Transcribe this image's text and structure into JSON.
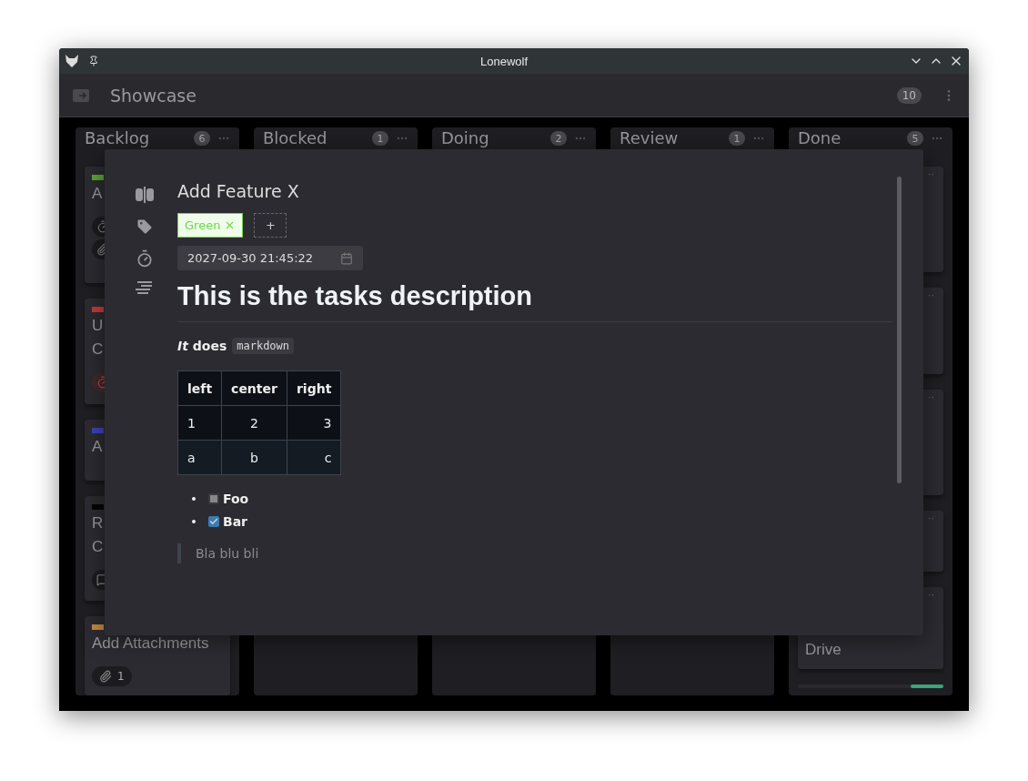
{
  "window": {
    "title": "Lonewolf"
  },
  "header": {
    "title": "Showcase",
    "count": "10"
  },
  "columns": [
    {
      "title": "Backlog",
      "count": "6",
      "cards": [
        {
          "color": "#5ba832",
          "lines": [
            "A"
          ],
          "badges": [
            {
              "kind": "timer",
              "overdue": false
            },
            {
              "kind": "attachment",
              "overdue": false
            }
          ]
        },
        {
          "color": "#c23b3b",
          "lines": [
            "U",
            "C"
          ],
          "badges": [
            {
              "kind": "timer",
              "overdue": true
            }
          ]
        },
        {
          "color": "#3b44b8",
          "lines": [
            "A"
          ]
        },
        {
          "color": "#050505",
          "lines": [
            "R",
            "C"
          ],
          "badges": [
            {
              "kind": "comment",
              "overdue": false
            }
          ]
        },
        {
          "color": "#c38a45",
          "lines": [
            "Add Attachments"
          ],
          "badges": [
            {
              "kind": "attachment",
              "overdue": false,
              "count": "1"
            }
          ]
        }
      ]
    },
    {
      "title": "Blocked",
      "count": "1"
    },
    {
      "title": "Doing",
      "count": "2"
    },
    {
      "title": "Review",
      "count": "1"
    },
    {
      "title": "Done",
      "count": "5",
      "cards": [
        {
          "menu": "··"
        },
        {
          "menu": "··"
        },
        {
          "menu": "··"
        },
        {
          "menu": "··"
        },
        {
          "menu": "··",
          "lines": [
            "Drive"
          ]
        }
      ]
    }
  ],
  "task": {
    "title": "Add Feature X",
    "tags": [
      {
        "label": "Green",
        "color": "#6fd64a"
      }
    ],
    "add_tag": "+",
    "due": "2027-09-30 21:45:22",
    "heading": "This is the tasks description",
    "paragraph": "*It* does",
    "code": "markdown",
    "table": {
      "columns": [
        {
          "label": "left",
          "kind": "left"
        },
        {
          "label": "center",
          "kind": "center"
        },
        {
          "label": "right",
          "kind": "right"
        }
      ],
      "rows": [
        [
          "1",
          "2",
          "3"
        ],
        [
          "a",
          "b",
          "c"
        ]
      ]
    },
    "tasks": [
      {
        "label": "Foo",
        "checked": false
      },
      {
        "label": "Bar",
        "checked": true
      }
    ],
    "quote": "Bla blu bli"
  }
}
